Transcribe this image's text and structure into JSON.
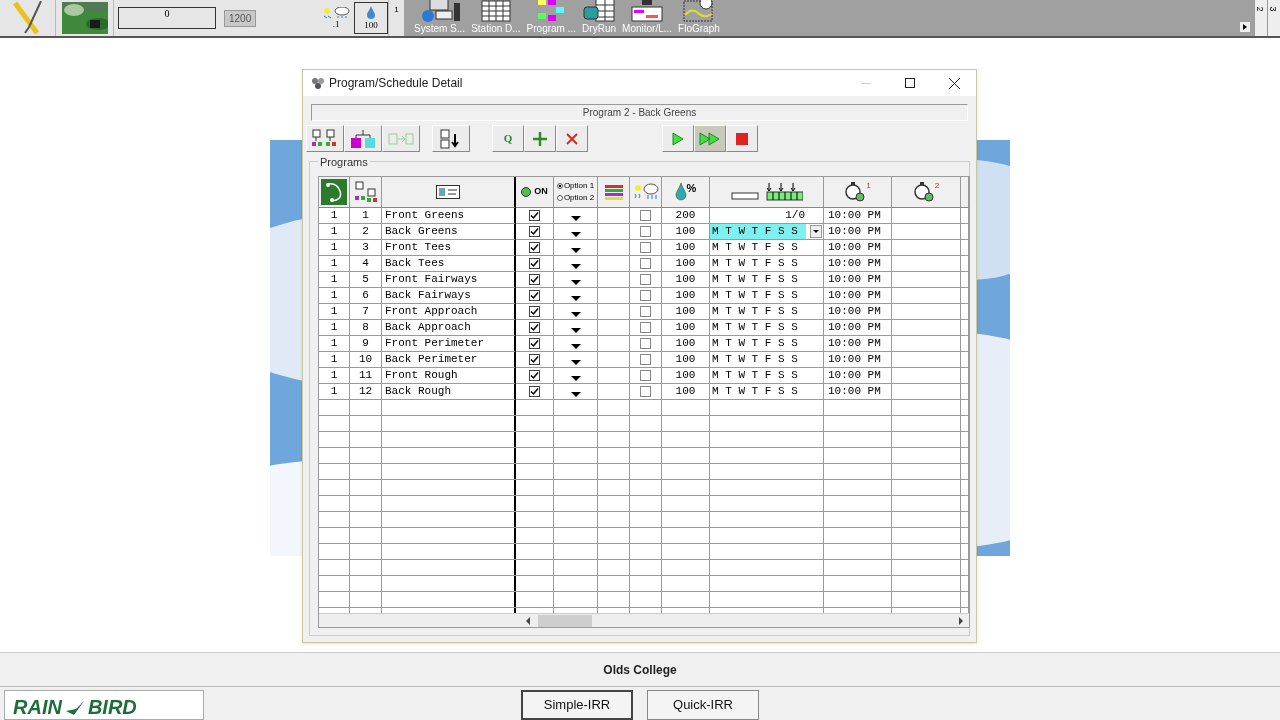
{
  "top_bar": {
    "gauge_value": "0",
    "max_value": "1200",
    "weather_value": ".1",
    "water_value": "100",
    "marker": "1",
    "tools": [
      {
        "kind": "system",
        "label": "System S..."
      },
      {
        "kind": "station",
        "label": "Station D..."
      },
      {
        "kind": "program",
        "label": "Program ..."
      },
      {
        "kind": "dryrun",
        "label": "DryRun"
      },
      {
        "kind": "monitor",
        "label": "Monitor/L..."
      },
      {
        "kind": "flograph",
        "label": "FloGraph"
      }
    ],
    "side_tabs": [
      "2",
      "3"
    ]
  },
  "window": {
    "title": "Program/Schedule Detail",
    "subtitle": "Program 2 - Back Greens",
    "toolbar": [
      {
        "kind": "tree",
        "pressed": false
      },
      {
        "kind": "branch",
        "pressed": false
      },
      {
        "kind": "move",
        "pressed": false
      },
      {
        "kind": "sort",
        "pressed": false
      },
      {
        "kind": "q",
        "label": "Q",
        "pressed": false
      },
      {
        "kind": "add",
        "pressed": false
      },
      {
        "kind": "delete",
        "pressed": false
      },
      {
        "kind": "play",
        "pressed": false
      },
      {
        "kind": "fastforward",
        "pressed": true
      },
      {
        "kind": "stop",
        "pressed": false
      }
    ],
    "group_label": "Programs",
    "header": {
      "on_label": "ON",
      "option_1": "Option 1",
      "option_2": "Option 2",
      "percent_label": "%",
      "start_1": "1",
      "start_2": "2"
    },
    "rows": [
      {
        "group": "1",
        "number": "1",
        "name": "Front Greens",
        "on": true,
        "option": false,
        "percent": "200",
        "days": "1/0",
        "selected": false,
        "start": "10:00 PM"
      },
      {
        "group": "1",
        "number": "2",
        "name": "Back Greens",
        "on": true,
        "option": false,
        "percent": "100",
        "days": "M T W T F S S",
        "selected": true,
        "start": "10:00 PM"
      },
      {
        "group": "1",
        "number": "3",
        "name": "Front Tees",
        "on": true,
        "option": false,
        "percent": "100",
        "days": "M T W T F S S",
        "selected": false,
        "start": "10:00 PM"
      },
      {
        "group": "1",
        "number": "4",
        "name": "Back Tees",
        "on": true,
        "option": false,
        "percent": "100",
        "days": "M T W T F S S",
        "selected": false,
        "start": "10:00 PM"
      },
      {
        "group": "1",
        "number": "5",
        "name": "Front Fairways",
        "on": true,
        "option": false,
        "percent": "100",
        "days": "M T W T F S S",
        "selected": false,
        "start": "10:00 PM"
      },
      {
        "group": "1",
        "number": "6",
        "name": "Back Fairways",
        "on": true,
        "option": false,
        "percent": "100",
        "days": "M T W T F S S",
        "selected": false,
        "start": "10:00 PM"
      },
      {
        "group": "1",
        "number": "7",
        "name": "Front Approach",
        "on": true,
        "option": false,
        "percent": "100",
        "days": "M T W T F S S",
        "selected": false,
        "start": "10:00 PM"
      },
      {
        "group": "1",
        "number": "8",
        "name": "Back Approach",
        "on": true,
        "option": false,
        "percent": "100",
        "days": "M T W T F S S",
        "selected": false,
        "start": "10:00 PM"
      },
      {
        "group": "1",
        "number": "9",
        "name": "Front Perimeter",
        "on": true,
        "option": false,
        "percent": "100",
        "days": "M T W T F S S",
        "selected": false,
        "start": "10:00 PM"
      },
      {
        "group": "1",
        "number": "10",
        "name": "Back Perimeter",
        "on": true,
        "option": false,
        "percent": "100",
        "days": "M T W T F S S",
        "selected": false,
        "start": "10:00 PM"
      },
      {
        "group": "1",
        "number": "11",
        "name": "Front Rough",
        "on": true,
        "option": false,
        "percent": "100",
        "days": "M T W T F S S",
        "selected": false,
        "start": "10:00 PM"
      },
      {
        "group": "1",
        "number": "12",
        "name": "Back Rough",
        "on": true,
        "option": false,
        "percent": "100",
        "days": "M T W T F S S",
        "selected": false,
        "start": "10:00 PM"
      }
    ]
  },
  "footer": {
    "site": "Olds College",
    "logo_words": [
      "RAIN",
      "BIRD"
    ],
    "buttons": [
      "Simple-IRR",
      "Quick-IRR"
    ]
  }
}
